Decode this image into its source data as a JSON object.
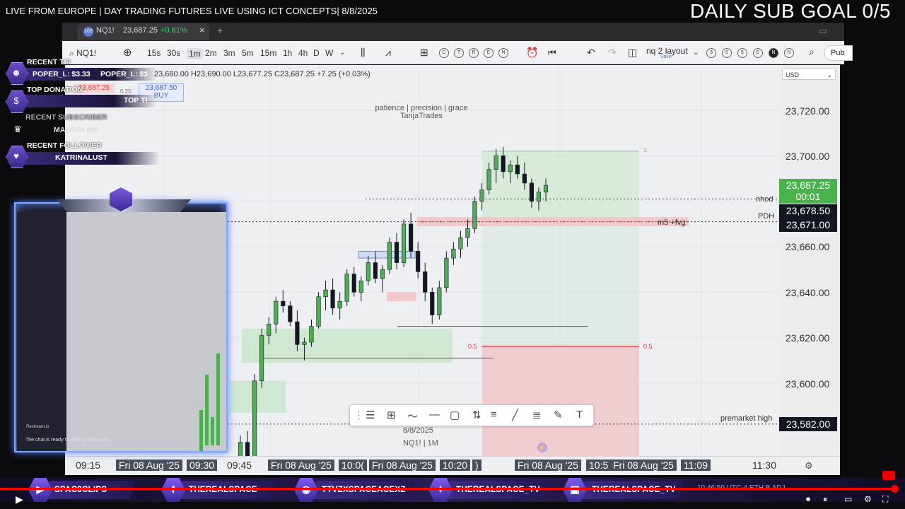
{
  "stream": {
    "title": "LIVE FROM EUROPE | DAY TRADING FUTURES LIVE USING ICT CONCEPTS| 8/8/2025",
    "sub_goal": "DAILY SUB GOAL 0/5"
  },
  "browser": {
    "tab_symbol": "NQ1!",
    "tab_price": "23,687.25",
    "tab_change": "+0.81%",
    "tab_logo": "100",
    "close_icon": "×",
    "add_icon": "+"
  },
  "toolbar": {
    "symbol": "NQ1!",
    "timeframes": [
      "15s",
      "30s",
      "1m",
      "2m",
      "3m",
      "5m",
      "15m",
      "1h",
      "4h",
      "D",
      "W"
    ],
    "active_timeframe": "1m",
    "circles_a": [
      "C",
      "T",
      "R",
      "E",
      "N"
    ],
    "layout_name": "nq 2 layout",
    "layout_sub": "Save",
    "circles_b": [
      "3",
      "6",
      "6",
      "E",
      "N",
      "N"
    ],
    "publish": "Pub"
  },
  "chart": {
    "ohlc": "23,680.00  H23,690.00  L23,677.25  C23,687.25  +7.25 (+0.03%)",
    "sell_price": "23,687.25",
    "buy_price": "23,687.50",
    "buy_label": "BUY",
    "spread": "0.25",
    "watermark_line1": "patience | precision | grace",
    "watermark_line2": "TanjaTrades",
    "currency": "USD",
    "price_ticks": [
      "23,720.00",
      "23,700.00",
      "23,660.00",
      "23,640.00",
      "23,620.00",
      "23,600.00"
    ],
    "current_price": "23,687.25",
    "countdown": "00:01",
    "pdh_price": "23,678.50",
    "fvg_price": "23,671.00",
    "premarket_price": "23,582.00",
    "line_labels": {
      "nhod": "nhod",
      "pdh": "PDH",
      "fvg": "m5 +fvg",
      "premarket": "premarket high",
      "fib_left": "0.5",
      "fib_right": "0.5",
      "box_corner": "1"
    },
    "footer_date": "8/8/2025",
    "footer_symbol": "NQ1! | 1M",
    "time_ticks": [
      "09:15",
      "Fri 08 Aug '25",
      "09:30",
      "09:45",
      "Fri 08 Aug '25",
      "10:0(",
      "Fri 08 Aug '25",
      "10:20",
      ")",
      "Fri 08 Aug '25",
      "10:5",
      "Fri 08 Aug '25",
      "11:09",
      "11:30"
    ]
  },
  "chart_data": {
    "type": "candlestick",
    "title": "",
    "ylim": [
      23570,
      23735
    ],
    "reference_levels": [
      {
        "name": "nhod",
        "value": 23681
      },
      {
        "name": "PDH",
        "value": 23678.5
      },
      {
        "name": "m5 +fvg",
        "value": 23671
      },
      {
        "name": "premarket high",
        "value": 23582
      },
      {
        "name": "0.5",
        "value": 23616
      }
    ],
    "candles": [
      [
        23560,
        23577,
        23555,
        23574
      ],
      [
        23574,
        23579,
        23562,
        23566
      ],
      [
        23566,
        23604,
        23564,
        23601
      ],
      [
        23601,
        23624,
        23598,
        23621
      ],
      [
        23621,
        23629,
        23617,
        23626
      ],
      [
        23626,
        23638,
        23622,
        23636
      ],
      [
        23636,
        23641,
        23631,
        23634
      ],
      [
        23634,
        23636,
        23625,
        23627
      ],
      [
        23627,
        23632,
        23614,
        23617
      ],
      [
        23617,
        23620,
        23610,
        23618
      ],
      [
        23618,
        23628,
        23616,
        23625
      ],
      [
        23625,
        23640,
        23624,
        23638
      ],
      [
        23638,
        23645,
        23632,
        23641
      ],
      [
        23641,
        23646,
        23630,
        23633
      ],
      [
        23633,
        23640,
        23628,
        23636
      ],
      [
        23636,
        23650,
        23634,
        23648
      ],
      [
        23648,
        23651,
        23638,
        23640
      ],
      [
        23640,
        23647,
        23636,
        23645
      ],
      [
        23645,
        23656,
        23643,
        23653
      ],
      [
        23653,
        23658,
        23644,
        23646
      ],
      [
        23646,
        23652,
        23640,
        23650
      ],
      [
        23650,
        23664,
        23648,
        23662
      ],
      [
        23662,
        23666,
        23650,
        23653
      ],
      [
        23653,
        23672,
        23651,
        23670
      ],
      [
        23670,
        23675,
        23655,
        23658
      ],
      [
        23658,
        23662,
        23646,
        23649
      ],
      [
        23649,
        23653,
        23636,
        23640
      ],
      [
        23640,
        23642,
        23626,
        23630
      ],
      [
        23630,
        23645,
        23628,
        23642
      ],
      [
        23642,
        23658,
        23640,
        23655
      ],
      [
        23655,
        23662,
        23652,
        23659
      ],
      [
        23659,
        23667,
        23655,
        23664
      ],
      [
        23664,
        23672,
        23660,
        23668
      ],
      [
        23668,
        23682,
        23666,
        23680
      ],
      [
        23680,
        23688,
        23676,
        23685
      ],
      [
        23685,
        23697,
        23683,
        23694
      ],
      [
        23694,
        23703,
        23688,
        23700
      ],
      [
        23700,
        23704,
        23690,
        23693
      ],
      [
        23693,
        23698,
        23688,
        23696
      ],
      [
        23696,
        23700,
        23690,
        23692
      ],
      [
        23692,
        23697,
        23685,
        23688
      ],
      [
        23688,
        23690,
        23677,
        23680
      ],
      [
        23680,
        23686,
        23676,
        23684
      ],
      [
        23684,
        23690,
        23680,
        23687
      ]
    ]
  },
  "overlay": {
    "recent_tip_title": "RECENT TIP",
    "recent_tip_value": "POPER_L: $3.33",
    "recent_tip_value2": "POPER_L: $3",
    "top_donation_title": "TOP DONATION",
    "top_donation_value": "TOP TI",
    "recent_sub_title": "RECENT SUBSCRIBER",
    "recent_sub_value": "MANGOLINII",
    "recent_follower_title": "RECENT FOLLOWER",
    "recent_follower_value": "KATRINALUST",
    "restream": "Restream.io",
    "chat_msg": "The chat is ready to display messages."
  },
  "social": [
    {
      "icon": "youtube-icon",
      "glyph": "▶",
      "label": "SPAC3CLIPS"
    },
    {
      "icon": "facebook-icon",
      "glyph": "f",
      "label": "THEREALSPACE"
    },
    {
      "icon": "discord-icon",
      "glyph": "◉",
      "label": "TTVZXSPACEACEXZ"
    },
    {
      "icon": "twitter-icon",
      "glyph": "✦",
      "label": "THEREALSPACE_TV"
    },
    {
      "icon": "twitch-icon",
      "glyph": "▣",
      "label": "THEREALSPACE_TV"
    }
  ],
  "status_ghost": "10:46:50 UTC-4  ETH  B ADJ",
  "colors": {
    "up": "#4caf50",
    "down": "#131722",
    "current_label": "#49b34b",
    "progress": "#ff0000",
    "overlay_purple": "#6b4ec9"
  }
}
